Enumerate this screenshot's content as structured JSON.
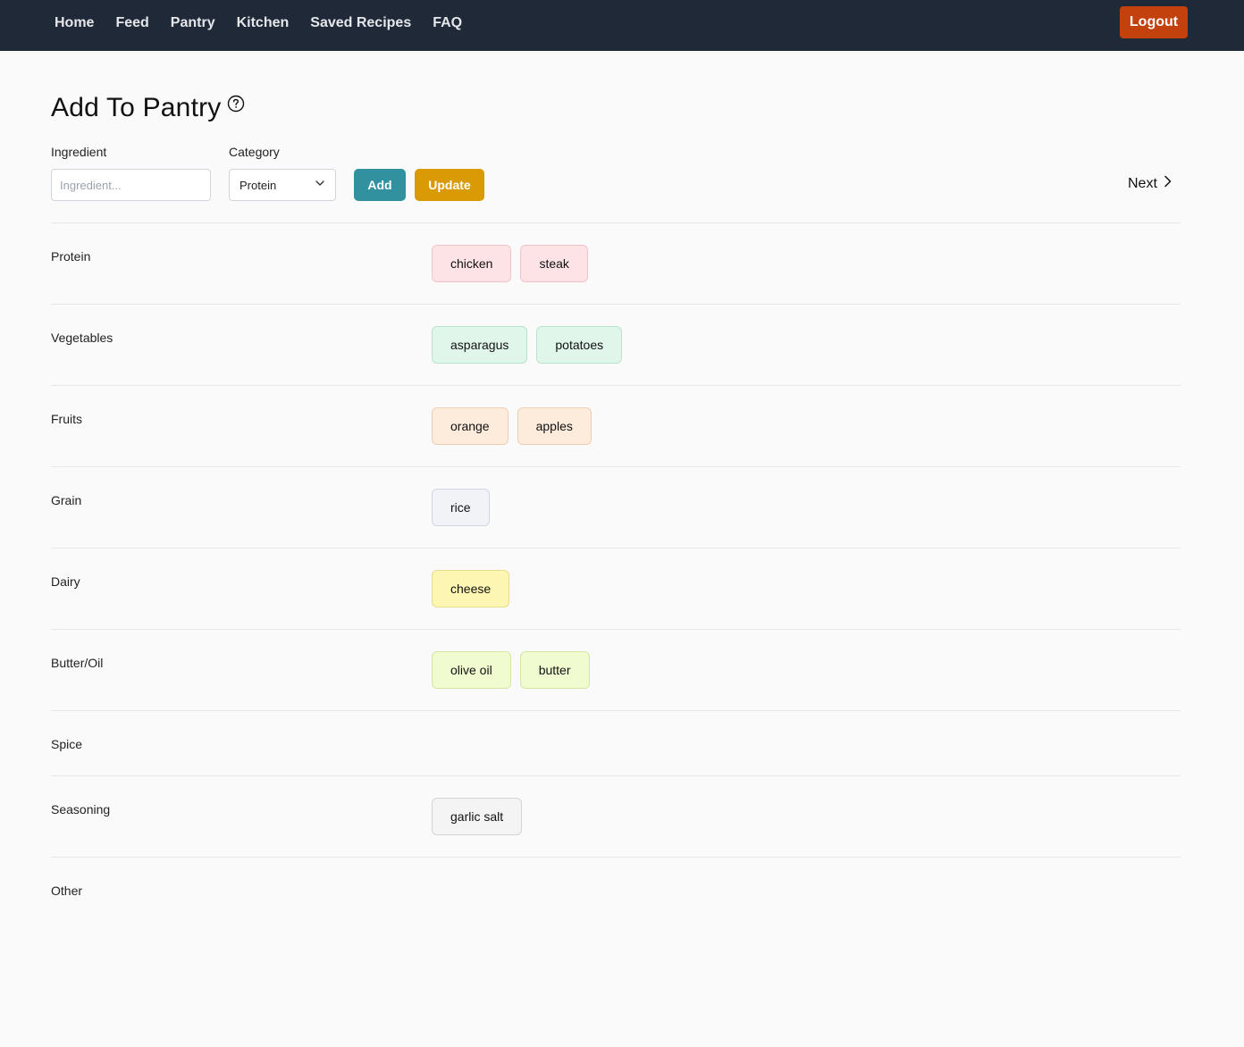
{
  "nav": {
    "items": [
      "Home",
      "Feed",
      "Pantry",
      "Kitchen",
      "Saved Recipes",
      "FAQ"
    ],
    "logout_label": "Logout"
  },
  "page": {
    "title": "Add To Pantry",
    "help_icon": "question-circle-icon"
  },
  "form": {
    "ingredient_label": "Ingredient",
    "ingredient_placeholder": "Ingredient...",
    "ingredient_value": "",
    "category_label": "Category",
    "category_value": "Protein",
    "add_label": "Add",
    "update_label": "Update",
    "next_label": "Next"
  },
  "colors": {
    "navbar": "#1f2937",
    "logout": "#c2410c",
    "add": "#31919e",
    "update": "#d99a06"
  },
  "categories": [
    {
      "name": "Protein",
      "items": [
        "chicken",
        "steak"
      ]
    },
    {
      "name": "Vegetables",
      "items": [
        "asparagus",
        "potatoes"
      ]
    },
    {
      "name": "Fruits",
      "items": [
        "orange",
        "apples"
      ]
    },
    {
      "name": "Grain",
      "items": [
        "rice"
      ]
    },
    {
      "name": "Dairy",
      "items": [
        "cheese"
      ]
    },
    {
      "name": "Butter/Oil",
      "items": [
        "olive oil",
        "butter"
      ]
    },
    {
      "name": "Spice",
      "items": []
    },
    {
      "name": "Seasoning",
      "items": [
        "garlic salt"
      ]
    },
    {
      "name": "Other",
      "items": []
    }
  ]
}
